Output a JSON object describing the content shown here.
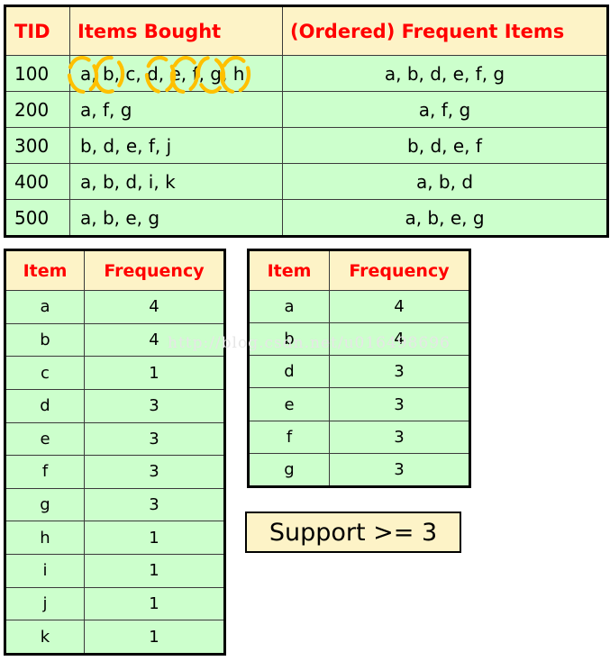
{
  "watermark": {
    "text": "http://blog.csdn.net/u016498696"
  },
  "transactions_table": {
    "name": "transactions-table",
    "headers": [
      "TID",
      "Items Bought",
      "(Ordered) Frequent Items"
    ],
    "rows": [
      {
        "tid": "100",
        "items_bought": "a, b, c, d, e, f, g, h",
        "ordered_frequent_items": "a, b, d, e, f, g"
      },
      {
        "tid": "200",
        "items_bought": "a, f, g",
        "ordered_frequent_items": "a, f, g"
      },
      {
        "tid": "300",
        "items_bought": "b, d, e, f, j",
        "ordered_frequent_items": "b, d, e, f"
      },
      {
        "tid": "400",
        "items_bought": "a, b, d, i, k",
        "ordered_frequent_items": "a, b, d"
      },
      {
        "tid": "500",
        "items_bought": "a, b, e, g",
        "ordered_frequent_items": "a, b, e, g"
      }
    ]
  },
  "frequency_all_table": {
    "name": "frequency-all-table",
    "headers": [
      "Item",
      "Frequency"
    ],
    "rows": [
      {
        "item": "a",
        "frequency": "4"
      },
      {
        "item": "b",
        "frequency": "4"
      },
      {
        "item": "c",
        "frequency": "1"
      },
      {
        "item": "d",
        "frequency": "3"
      },
      {
        "item": "e",
        "frequency": "3"
      },
      {
        "item": "f",
        "frequency": "3"
      },
      {
        "item": "g",
        "frequency": "3"
      },
      {
        "item": "h",
        "frequency": "1"
      },
      {
        "item": "i",
        "frequency": "1"
      },
      {
        "item": "j",
        "frequency": "1"
      },
      {
        "item": "k",
        "frequency": "1"
      }
    ]
  },
  "frequency_filtered_table": {
    "name": "frequency-filtered-table",
    "headers": [
      "Item",
      "Frequency"
    ],
    "rows": [
      {
        "item": "a",
        "frequency": "4"
      },
      {
        "item": "b",
        "frequency": "4"
      },
      {
        "item": "d",
        "frequency": "3"
      },
      {
        "item": "e",
        "frequency": "3"
      },
      {
        "item": "f",
        "frequency": "3"
      },
      {
        "item": "g",
        "frequency": "3"
      }
    ]
  },
  "support_note": {
    "text": "Support >= 3"
  },
  "annotations": {
    "description": "hand-drawn orange circles highlighting frequent items in TID 100 row",
    "color": "#ffc000",
    "circled_items": [
      "a",
      "b",
      "d",
      "e",
      "f",
      "g"
    ]
  },
  "colors": {
    "header_background": "#fdf3c7",
    "cell_background": "#ccffcc",
    "header_text": "#ff0000",
    "body_text": "#000000",
    "border": "#000000",
    "annotation": "#ffc000",
    "watermark": "#e6e6e6"
  }
}
